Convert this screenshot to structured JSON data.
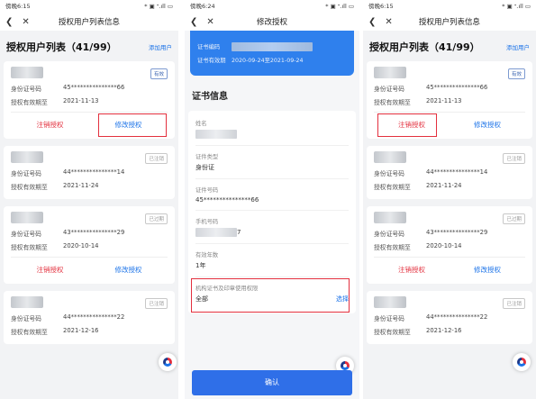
{
  "panel1": {
    "status": {
      "time": "傍晚6:15",
      "right": "* ▣ ᐩ.ıll ▭"
    },
    "nav_title": "授权用户列表信息",
    "list_title": "授权用户列表（41/99）",
    "add_label": "添加用户",
    "cards": [
      {
        "badge": "有效",
        "id_label": "身份证号码",
        "id": "45***************66",
        "exp_label": "授权有效期至",
        "exp": "2021-11-13",
        "cancel": "注销授权",
        "modify": "修改授权"
      },
      {
        "badge": "已注销",
        "id_label": "身份证号码",
        "id": "44***************14",
        "exp_label": "授权有效期至",
        "exp": "2021-11-24"
      },
      {
        "badge": "已过期",
        "id_label": "身份证号码",
        "id": "43***************29",
        "exp_label": "授权有效期至",
        "exp": "2020-10-14",
        "cancel": "注销授权",
        "modify": "修改授权"
      },
      {
        "badge": "已注销",
        "id_label": "身份证号码",
        "id": "44***************22",
        "exp_label": "授权有效期至",
        "exp": "2021-12-16"
      }
    ]
  },
  "panel2": {
    "status": {
      "time": "傍晚6:24",
      "right": "* ▣ ᐩ.ıll ▭"
    },
    "nav_title": "修改授权",
    "cert_code_label": "证书编码",
    "cert_valid_label": "证书有效期",
    "cert_valid": "2020-09-24至2021-09-24",
    "section_title": "证书信息",
    "fields": {
      "name_label": "姓名",
      "idtype_label": "证件类型",
      "idtype": "身份证",
      "idno_label": "证件号码",
      "idno": "45***************66",
      "phone_label": "手机号码",
      "phone_tail": "7",
      "years_label": "有效年数",
      "years": "1年",
      "perm_label": "机构证书及印章使用权限",
      "perm": "全部",
      "perm_select": "选择"
    },
    "confirm": "确认"
  },
  "panel3": {
    "status": {
      "time": "傍晚6:15",
      "right": "* ▣ ᐩ.ıll ▭"
    },
    "nav_title": "授权用户列表信息",
    "list_title": "授权用户列表（41/99）",
    "add_label": "添加用户",
    "cards": [
      {
        "badge": "有效",
        "id_label": "身份证号码",
        "id": "45***************66",
        "exp_label": "授权有效期至",
        "exp": "2021-11-13",
        "cancel": "注销授权",
        "modify": "修改授权"
      },
      {
        "badge": "已注销",
        "id_label": "身份证号码",
        "id": "44***************14",
        "exp_label": "授权有效期至",
        "exp": "2021-11-24"
      },
      {
        "badge": "已过期",
        "id_label": "身份证号码",
        "id": "43***************29",
        "exp_label": "授权有效期至",
        "exp": "2020-10-14",
        "cancel": "注销授权",
        "modify": "修改授权"
      },
      {
        "badge": "已注销",
        "id_label": "身份证号码",
        "id": "44***************22",
        "exp_label": "授权有效期至",
        "exp": "2021-12-16"
      }
    ]
  },
  "nav_icons": [
    "back-icon",
    "close-icon"
  ],
  "colors": {
    "accent": "#1a72e8",
    "danger": "#e3303e",
    "header_blue": "#2f80ed"
  }
}
